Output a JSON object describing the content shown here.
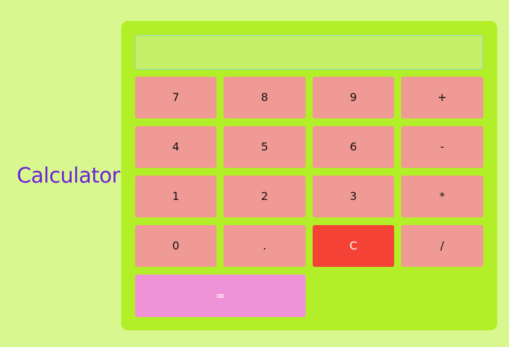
{
  "title": "Calculator",
  "display": {
    "value": "",
    "placeholder": ""
  },
  "keys": {
    "k7": "7",
    "k8": "8",
    "k9": "9",
    "plus": "+",
    "k4": "4",
    "k5": "5",
    "k6": "6",
    "minus": "-",
    "k1": "1",
    "k2": "2",
    "k3": "3",
    "multiply": "*",
    "k0": "0",
    "decimal": ".",
    "clear": "C",
    "divide": "/",
    "equals": "="
  },
  "colors": {
    "page_background": "#d8f78f",
    "calculator_background": "#b2ef29",
    "display_background": "#c5ef66",
    "key_background": "#f09a95",
    "clear_background": "#f44336",
    "equals_background": "#f092d8",
    "title_color": "#6b21d9"
  }
}
